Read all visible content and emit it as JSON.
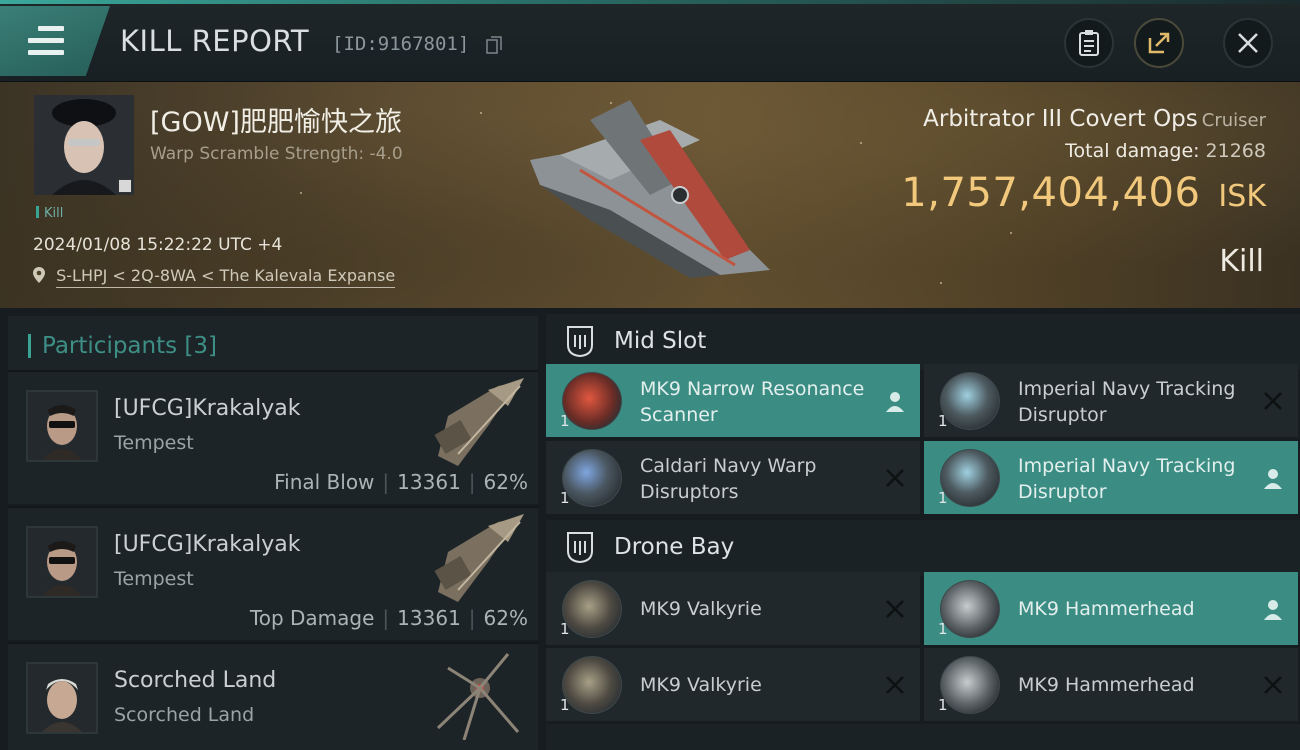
{
  "header": {
    "title": "KILL REPORT",
    "report_id": "[ID:9167801]",
    "menu_icon": "hamburger-menu-icon",
    "buttons": [
      "clipboard-icon",
      "share-icon",
      "close-icon"
    ]
  },
  "victim": {
    "name": "[GOW]肥肥愉快之旅",
    "subtitle": "Warp Scramble Strength: -4.0",
    "tag": "Kill",
    "datetime": "2024/01/08 15:22:22 UTC +4",
    "location": "S-LHPJ < 2Q-8WA < The Kalevala Expanse",
    "ship": "Arbitrator III Covert Ops",
    "ship_class": "Cruiser",
    "total_damage_label": "Total damage:",
    "total_damage": "21268",
    "isk_value": "1,757,404,406",
    "isk_unit": "ISK",
    "result": "Kill"
  },
  "participants": {
    "label": "Participants",
    "count": "[3]",
    "rows": [
      {
        "name": "[UFCG]Krakalyak",
        "ship": "Tempest",
        "role": "Final Blow",
        "damage": "13361",
        "pct": "62%"
      },
      {
        "name": "[UFCG]Krakalyak",
        "ship": "Tempest",
        "role": "Top Damage",
        "damage": "13361",
        "pct": "62%"
      },
      {
        "name": "Scorched Land",
        "ship": "Scorched Land",
        "role": "",
        "damage": "",
        "pct": ""
      }
    ]
  },
  "mid_slot": {
    "label": "Mid Slot",
    "items": [
      {
        "qty": "1",
        "name": "MK9 Narrow Resonance Scanner",
        "state": "dropped"
      },
      {
        "qty": "1",
        "name": "Imperial Navy Tracking Disruptor",
        "state": "destroyed"
      },
      {
        "qty": "1",
        "name": "Caldari Navy Warp Disruptors",
        "state": "destroyed"
      },
      {
        "qty": "1",
        "name": "Imperial Navy Tracking Disruptor",
        "state": "dropped"
      }
    ]
  },
  "drone_bay": {
    "label": "Drone Bay",
    "items": [
      {
        "qty": "1",
        "name": "MK9  Valkyrie",
        "state": "destroyed"
      },
      {
        "qty": "1",
        "name": "MK9  Hammerhead",
        "state": "dropped"
      },
      {
        "qty": "1",
        "name": "MK9  Valkyrie",
        "state": "destroyed"
      },
      {
        "qty": "1",
        "name": "MK9  Hammerhead",
        "state": "destroyed"
      }
    ]
  },
  "colors": {
    "accent": "#3b8d84",
    "isk": "#f2c97c"
  }
}
